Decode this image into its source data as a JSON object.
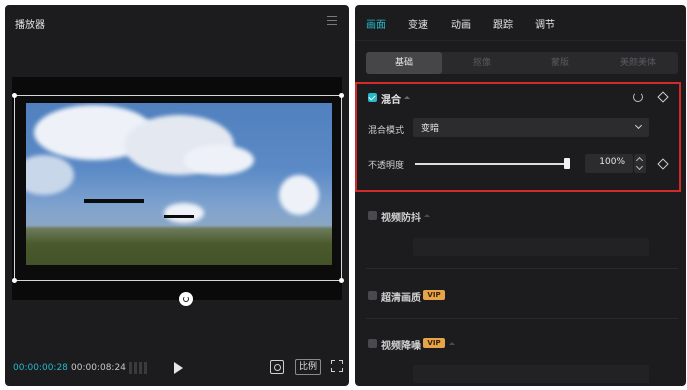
{
  "player": {
    "title": "播放器",
    "current_time": "00:00:00:28",
    "total_time": "00:00:08:24",
    "ratio_label": "比例"
  },
  "panel": {
    "tabs": [
      {
        "label": "画面",
        "active": true
      },
      {
        "label": "变速",
        "active": false
      },
      {
        "label": "动画",
        "active": false
      },
      {
        "label": "跟踪",
        "active": false
      },
      {
        "label": "调节",
        "active": false
      }
    ],
    "subtabs": [
      {
        "label": "基础",
        "active": true
      },
      {
        "label": "抠像",
        "active": false
      },
      {
        "label": "蒙版",
        "active": false
      },
      {
        "label": "美颜美体",
        "active": false
      }
    ],
    "blend": {
      "title": "混合",
      "checked": true,
      "mode_label": "混合模式",
      "mode_value": "变暗",
      "opacity_label": "不透明度",
      "opacity_value": "100%",
      "opacity_level": 1.0
    },
    "stabilize": {
      "title": "视频防抖",
      "checked": false
    },
    "enhance": {
      "title": "超清画质",
      "checked": false,
      "badge": "VIP"
    },
    "denoise": {
      "title": "视频降噪",
      "checked": false,
      "badge": "VIP"
    }
  },
  "colors": {
    "accent": "#25b9c9",
    "highlight": "#d22a2a",
    "vip": "#e6a54a",
    "panel_bg": "#1c1c1f"
  },
  "icons": [
    "menu-icon",
    "rotate-icon",
    "grid-icon",
    "play-icon",
    "fit-icon",
    "fullscreen-icon",
    "reset-icon",
    "keyframe-diamond-icon",
    "chevron-down-icon",
    "checkbox-icon"
  ]
}
